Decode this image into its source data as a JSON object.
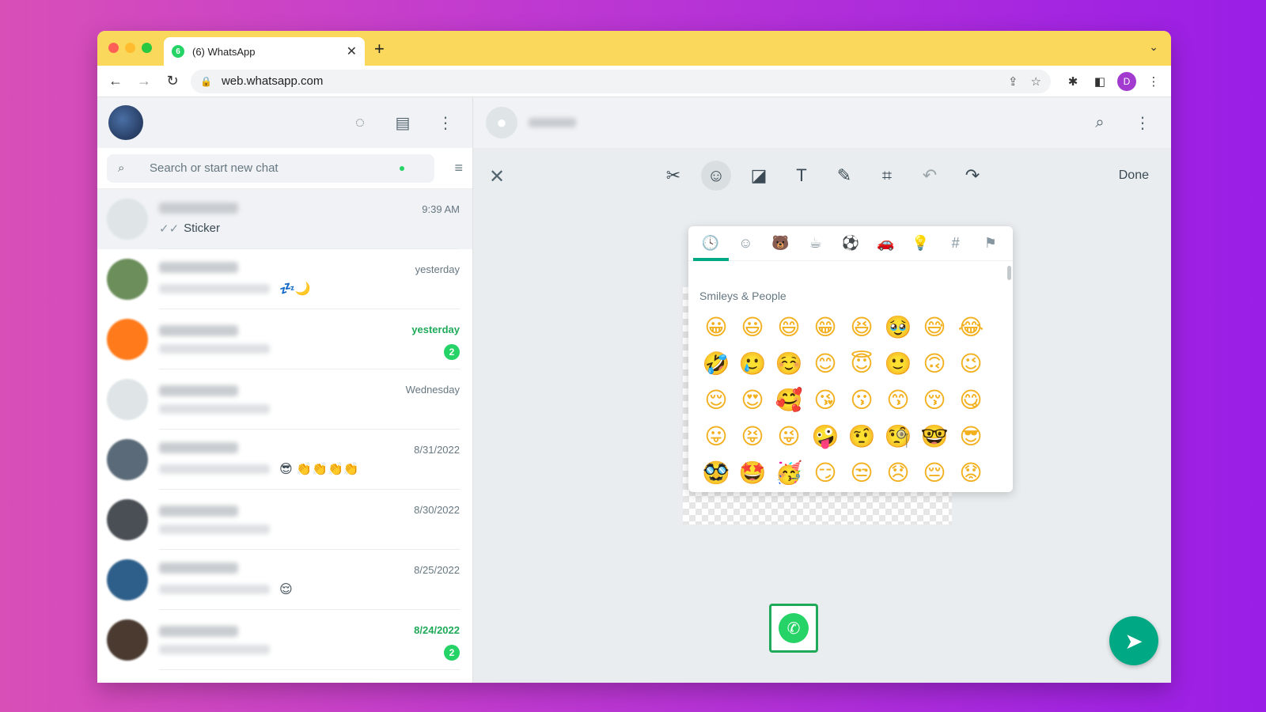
{
  "colors": {
    "tab_strip": "#f9d85c",
    "whatsapp_green": "#25d366",
    "teal": "#00a884",
    "arrow_red": "#f0203c",
    "profile_purple": "#a23ad0"
  },
  "browser": {
    "tab_title": "(6) WhatsApp",
    "tab_favicon_badge": "6",
    "tab_close": "✕",
    "new_tab": "+",
    "tab_menu": "⌄",
    "url": "web.whatsapp.com",
    "profile_initial": "D"
  },
  "left_panel": {
    "search_placeholder": "Search or start new chat",
    "chats": [
      {
        "time": "9:39 AM",
        "last_message": "Sticker",
        "ticks": "✓✓",
        "active": true,
        "avatar": "#dfe5e7"
      },
      {
        "time": "yesterday",
        "emoji": "💤🌙",
        "avatar": "#6b8e5a"
      },
      {
        "time": "yesterday",
        "unread": "2",
        "avatar": "#ff7a1a",
        "highlight": true
      },
      {
        "time": "Wednesday",
        "avatar": "#dfe5e7"
      },
      {
        "time": "8/31/2022",
        "emoji": "😎 👏👏👏👏",
        "avatar": "#5a6a78"
      },
      {
        "time": "8/30/2022",
        "avatar": "#4a4f55"
      },
      {
        "time": "8/25/2022",
        "emoji": "😌",
        "avatar": "#2e5f8a"
      },
      {
        "time": "8/24/2022",
        "unread": "2",
        "avatar": "#4a3a30",
        "highlight": true
      }
    ]
  },
  "editor": {
    "done_label": "Done",
    "tools": [
      "scissors-icon",
      "emoji-icon",
      "sticker-icon",
      "text-icon",
      "pencil-icon",
      "crop-icon",
      "undo-icon",
      "redo-icon"
    ]
  },
  "emoji_panel": {
    "section_title": "Smileys & People",
    "categories": [
      "🕓",
      "☺",
      "🐻",
      "☕",
      "⚽",
      "🚗",
      "💡",
      "#",
      "⚑"
    ],
    "emojis": [
      "😀",
      "😃",
      "😄",
      "😁",
      "😆",
      "🥹",
      "😅",
      "😂",
      "🤣",
      "🥲",
      "☺️",
      "😊",
      "😇",
      "🙂",
      "🙃",
      "😉",
      "😌",
      "😍",
      "🥰",
      "😘",
      "😗",
      "😙",
      "😚",
      "😋",
      "😛",
      "😝",
      "😜",
      "🤪",
      "🤨",
      "🧐",
      "🤓",
      "😎",
      "🥸",
      "🤩",
      "🥳",
      "😏",
      "😒",
      "😞",
      "😔",
      "😟"
    ]
  }
}
